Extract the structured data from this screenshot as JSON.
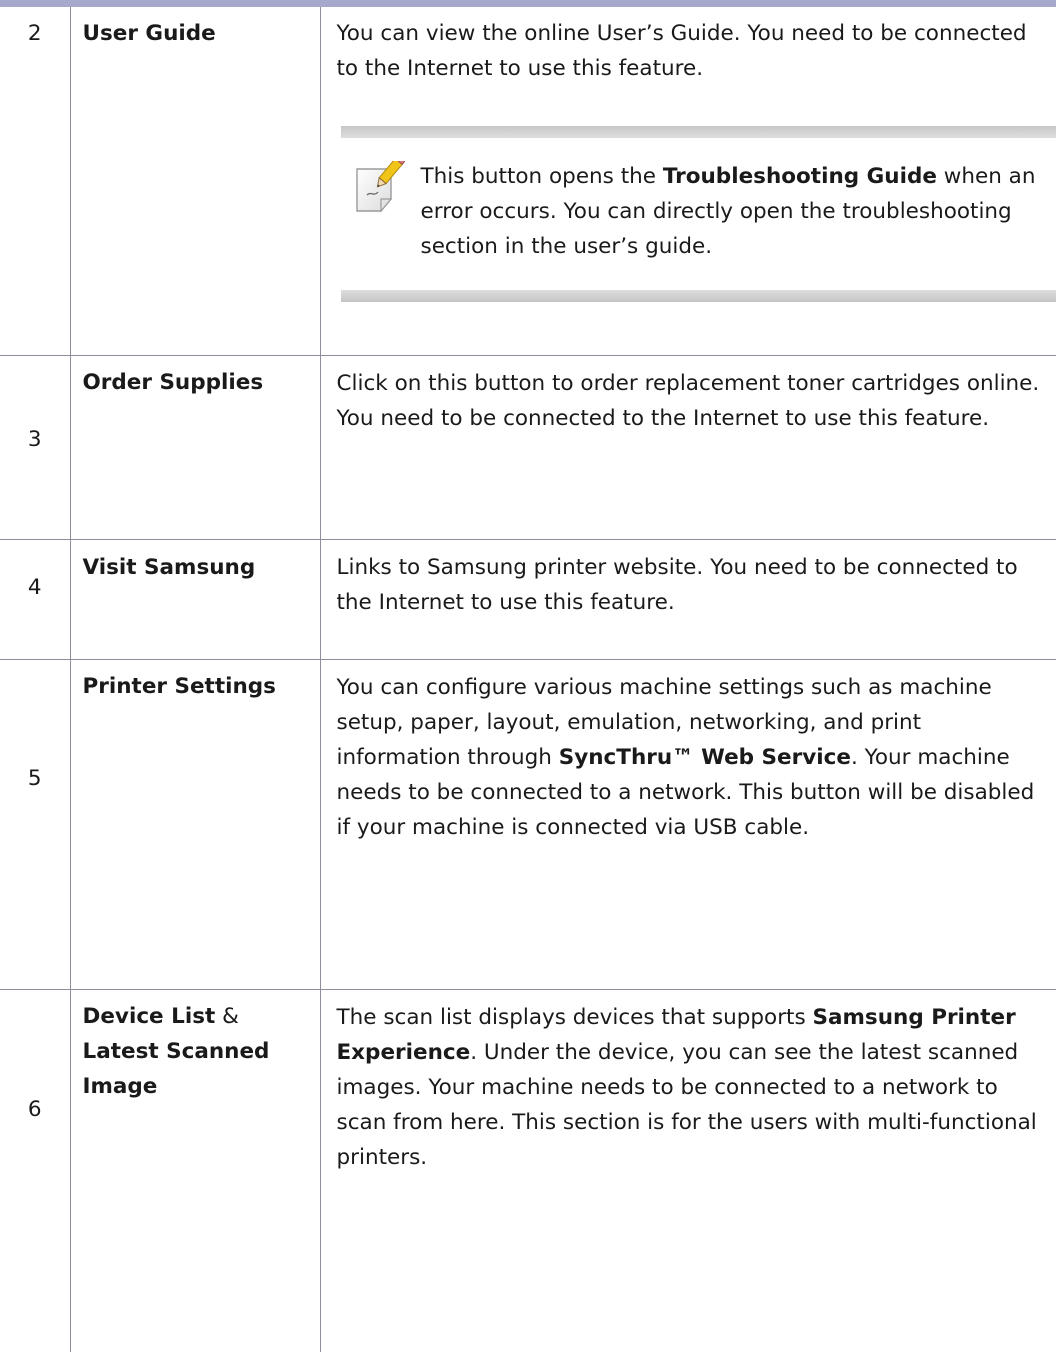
{
  "table": {
    "rows": [
      {
        "number": "2",
        "name": "User Guide",
        "description": "You can view the online User’s Guide. You need to be connected to the Internet to use this feature.",
        "note": {
          "icon": "note-pencil-icon",
          "text_before": "This button opens the ",
          "text_bold": "Troubleshooting Guide",
          "text_after": " when an error occurs. You can directly open the troubleshooting section in the user’s guide."
        }
      },
      {
        "number": "3",
        "name": "Order Supplies",
        "description": "Click on this button to order replacement toner cartridges online. You need to be connected to the Internet to use this feature."
      },
      {
        "number": "4",
        "name": "Visit Samsung",
        "description": "Links to Samsung printer website. You need to be connected to the Internet to use this feature."
      },
      {
        "number": "5",
        "name": "Printer Settings",
        "description_before": "You can configure various machine settings such as machine setup, paper, layout, emulation, networking, and print information through ",
        "description_bold": "SyncThru™ Web Service",
        "description_after": ". Your machine needs to be connected to a network. This button will be disabled if your machine is connected via USB cable."
      },
      {
        "number": "6",
        "name_part1": "Device List",
        "name_joiner": " & ",
        "name_part2": "Latest Scanned Image",
        "description_before": "The scan list displays devices that supports ",
        "description_bold": "Samsung Printer Experience",
        "description_after": ". Under the device, you can see the latest scanned images. Your machine needs to be connected to a network to scan from here. This section is for the users with multi-functional printers."
      }
    ]
  },
  "colors": {
    "top_rule": "#a7a9cc",
    "grid_lines": "#8d8d9c",
    "note_bar": "#d2d2d2",
    "note_icon_pencil": "#f0c419"
  }
}
